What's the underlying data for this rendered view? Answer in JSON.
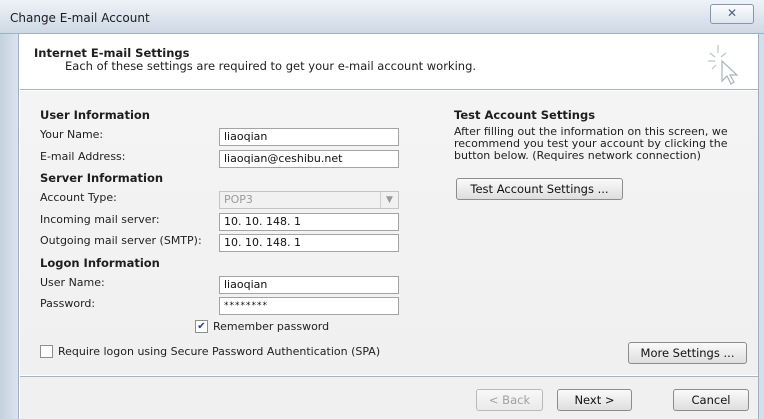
{
  "window": {
    "title": "Change E-mail Account",
    "close_glyph": "☒"
  },
  "header": {
    "title": "Internet E-mail Settings",
    "subtitle": "Each of these settings are required to get your e-mail account working."
  },
  "user_info": {
    "heading": "User Information",
    "name_label": "Your Name:",
    "name_value": "liaoqian",
    "email_label": "E-mail Address:",
    "email_value": "liaoqian@ceshibu.net"
  },
  "server_info": {
    "heading": "Server Information",
    "account_type_label": "Account Type:",
    "account_type_value": "POP3",
    "incoming_label": "Incoming mail server:",
    "incoming_value": "10. 10. 148. 1",
    "outgoing_label": "Outgoing mail server (SMTP):",
    "outgoing_value": "10. 10. 148. 1"
  },
  "logon_info": {
    "heading": "Logon Information",
    "username_label": "User Name:",
    "username_value": "liaoqian",
    "password_label": "Password:",
    "password_value": "********",
    "remember_label": "Remember password",
    "remember_checked": true,
    "spa_label": "Require logon using Secure Password Authentication (SPA)",
    "spa_checked": false
  },
  "test_settings": {
    "heading": "Test Account Settings",
    "description": "After filling out the information on this screen, we recommend you test your account by clicking the button below. (Requires network connection)",
    "button_label": "Test Account Settings ..."
  },
  "buttons": {
    "more_settings": "More Settings ...",
    "back": "< Back",
    "next": "Next >",
    "cancel": "Cancel"
  }
}
